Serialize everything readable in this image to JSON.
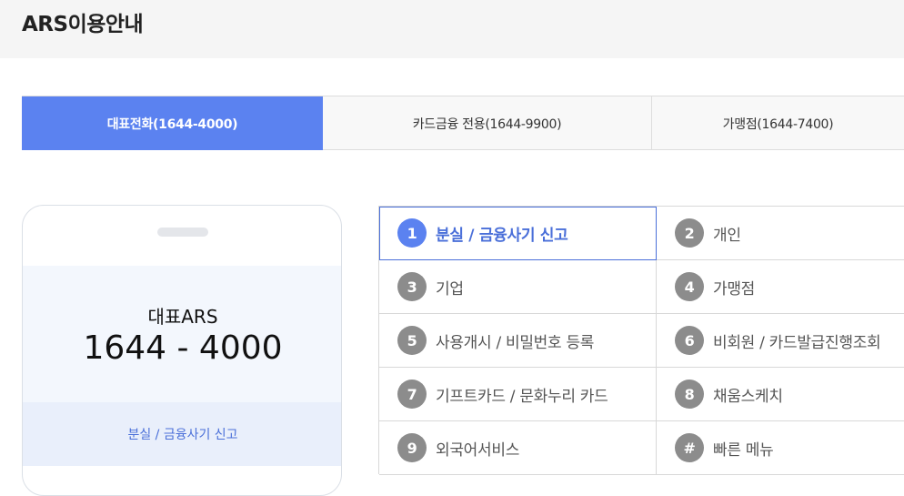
{
  "page_title": "ARS이용안내",
  "tabs": [
    {
      "label": "대표전화(1644-4000)",
      "active": true
    },
    {
      "label": "카드금융 전용(1644-9900)",
      "active": false
    },
    {
      "label": "가맹점(1644-7400)",
      "active": false
    }
  ],
  "phone": {
    "label": "대표ARS",
    "number": "1644 - 4000",
    "current_selection": "분실 / 금융사기 신고"
  },
  "menu": [
    {
      "num": "1",
      "label": "분실 / 금융사기 신고",
      "active": true
    },
    {
      "num": "2",
      "label": "개인",
      "active": false
    },
    {
      "num": "3",
      "label": "기업",
      "active": false
    },
    {
      "num": "4",
      "label": "가맹점",
      "active": false
    },
    {
      "num": "5",
      "label": "사용개시 / 비밀번호 등록",
      "active": false
    },
    {
      "num": "6",
      "label": "비회원 / 카드발급진행조회",
      "active": false
    },
    {
      "num": "7",
      "label": "기프트카드 / 문화누리 카드",
      "active": false
    },
    {
      "num": "8",
      "label": "채움스케치",
      "active": false
    },
    {
      "num": "9",
      "label": "외국어서비스",
      "active": false
    },
    {
      "num": "#",
      "label": "빠른 메뉴",
      "active": false
    }
  ],
  "colors": {
    "accent": "#5b82f0",
    "accent_text": "#4a6fd9",
    "number_badge": "#8c8c8c"
  }
}
